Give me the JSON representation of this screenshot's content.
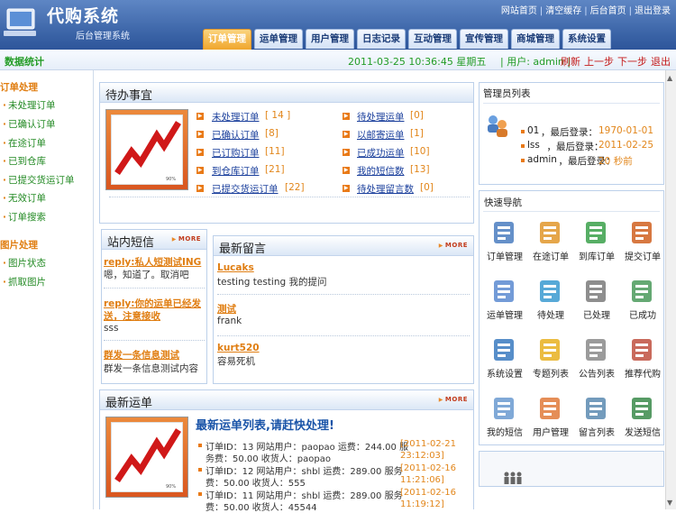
{
  "brand": {
    "title": "代购系统",
    "subtitle": "后台管理系统"
  },
  "top_links": [
    "网站首页",
    "清空缓存",
    "后台首页",
    "退出登录"
  ],
  "nav_tabs": [
    "订单管理",
    "运单管理",
    "用户管理",
    "日志记录",
    "互动管理",
    "宣传管理",
    "商城管理",
    "系统设置"
  ],
  "active_tab": "订单管理",
  "statusbar": {
    "label": "数据统计",
    "datetime": "2011-03-25 10:36:45 星期五",
    "user": "| 用户: admin |",
    "links": [
      "刷新",
      "上一步",
      "下一步",
      "退出"
    ]
  },
  "sidebar": {
    "order_header": "订单处理",
    "order_items": [
      "未处理订单",
      "已确认订单",
      "在途订单",
      "已到仓库",
      "已提交货运订单",
      "无效订单",
      "订单搜索"
    ],
    "image_header": "图片处理",
    "image_items": [
      "图片状态",
      "抓取图片"
    ]
  },
  "todo": {
    "title": "待办事宜",
    "left": [
      {
        "label": "未处理订单",
        "count": "[ 14 ]"
      },
      {
        "label": "已确认订单",
        "count": "[8]"
      },
      {
        "label": "已订购订单",
        "count": "[11]"
      },
      {
        "label": "到仓库订单",
        "count": "[21]"
      },
      {
        "label": "已提交货运订单",
        "count": "[22]"
      }
    ],
    "right": [
      {
        "label": "待处理运单",
        "count": "[0]"
      },
      {
        "label": "以邮寄运单",
        "count": "[1]"
      },
      {
        "label": "已成功运单",
        "count": "[10]"
      },
      {
        "label": "我的短信数",
        "count": "[13]"
      },
      {
        "label": "待处理留言数",
        "count": "[0]"
      }
    ]
  },
  "admins": {
    "title": "管理员列表",
    "rows": [
      {
        "name": "01",
        "label": "，最后登录：",
        "time": "1970-01-01"
      },
      {
        "name": "lss",
        "label": "，最后登录：",
        "time": "2011-02-25"
      },
      {
        "name": "admin",
        "label": "，最后登录：",
        "time": "20 秒前"
      }
    ]
  },
  "messages": {
    "title": "站内短信",
    "more": "MORE",
    "items": [
      {
        "title": "reply:私人短测试ING",
        "body": "嗯，知道了。取消吧"
      },
      {
        "title1": "reply:你的运单已经发",
        "title2": "送，注意接收",
        "body": "sss"
      },
      {
        "title": "群发一条信息测试",
        "body": "群发一条信息测试内容"
      }
    ]
  },
  "comments": {
    "title": "最新留言",
    "more": "MORE",
    "items": [
      {
        "author": "Lucaks",
        "body": "testing testing 我的提问"
      },
      {
        "author": "测试",
        "body": "frank"
      },
      {
        "author": "kurt520",
        "body": "容易死机"
      }
    ]
  },
  "waybills": {
    "title": "最新运单",
    "more": "MORE",
    "headline": "最新运单列表,请赶快处理!",
    "items": [
      {
        "line1": "订单ID：13 网站用户：paopao 运费：244.00 服",
        "line2": "务费：50.00 收货人：paopao",
        "date": "[2011-02-21",
        "time": "23:12:03]"
      },
      {
        "line1": "订单ID：12 网站用户：shbl 运费：289.00 服务",
        "line2": "费：50.00 收货人：555",
        "date": "[2011-02-16",
        "time": "11:21:06]"
      },
      {
        "line1": "订单ID：11 网站用户：shbl 运费：289.00 服务",
        "line2": "费：50.00 收货人：45544",
        "date": "[2011-02-16",
        "time": "11:19:12]"
      }
    ]
  },
  "quicknav": {
    "title": "快速导航",
    "items": [
      {
        "label": "订单管理",
        "icon": "order-icon"
      },
      {
        "label": "在途订单",
        "icon": "transit-icon"
      },
      {
        "label": "到库订单",
        "icon": "warehouse-icon"
      },
      {
        "label": "提交订单",
        "icon": "submit-icon"
      },
      {
        "label": "运单管理",
        "icon": "waybill-icon"
      },
      {
        "label": "待处理",
        "icon": "pending-icon"
      },
      {
        "label": "已处理",
        "icon": "processed-icon"
      },
      {
        "label": "已成功",
        "icon": "success-icon"
      },
      {
        "label": "系统设置",
        "icon": "settings-icon"
      },
      {
        "label": "专题列表",
        "icon": "star-icon"
      },
      {
        "label": "公告列表",
        "icon": "notice-icon"
      },
      {
        "label": "推荐代购",
        "icon": "recommend-icon"
      },
      {
        "label": "我的短信",
        "icon": "mail-icon"
      },
      {
        "label": "用户管理",
        "icon": "users-icon"
      },
      {
        "label": "留言列表",
        "icon": "comment-icon"
      },
      {
        "label": "发送短信",
        "icon": "send-icon"
      }
    ]
  },
  "colors": {
    "accent_orange": "#e07e12",
    "brand_blue": "#3a63a6",
    "link_blue": "#1a3f9c",
    "green": "#239c25"
  }
}
